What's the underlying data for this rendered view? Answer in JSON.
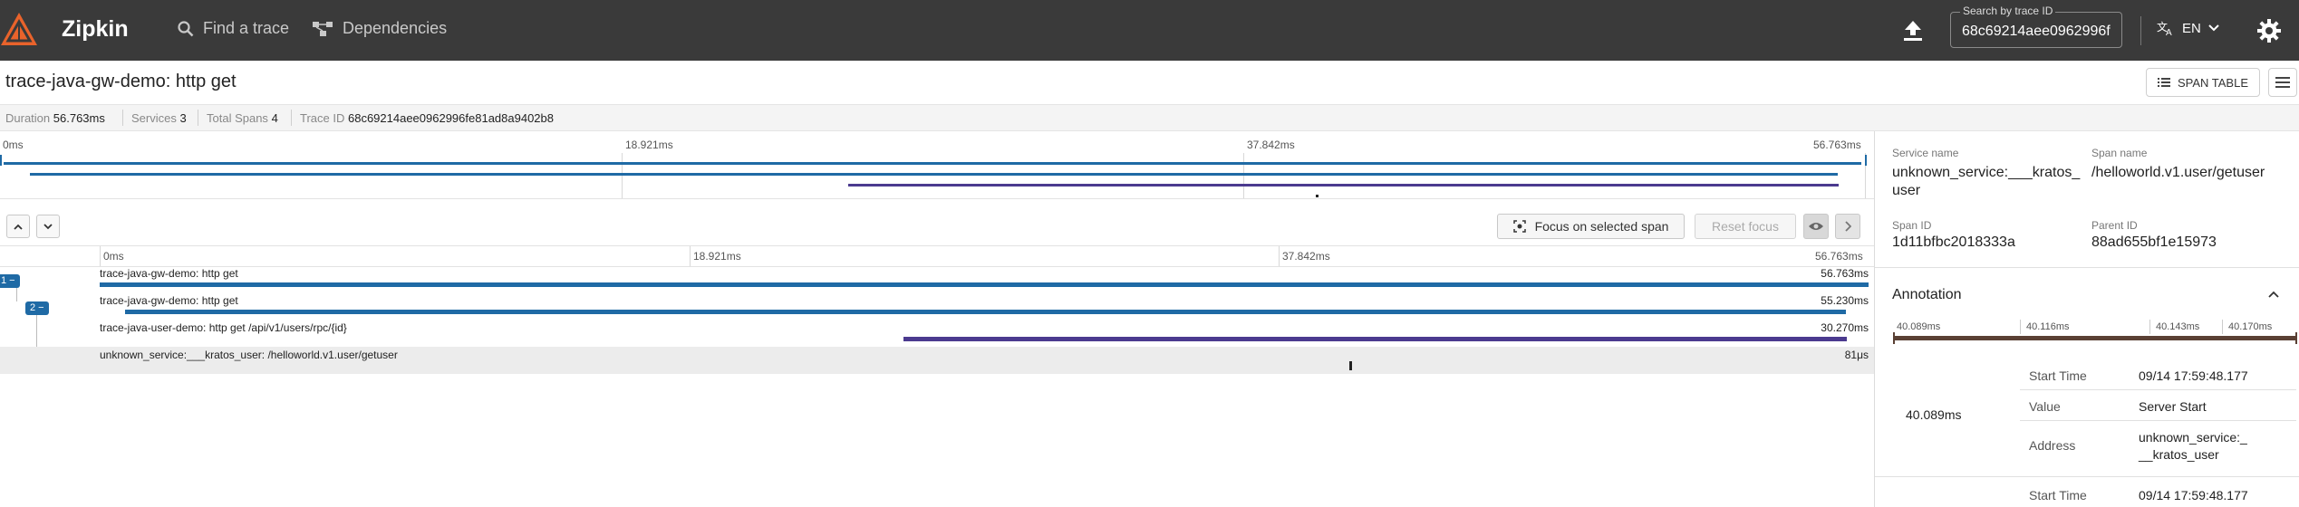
{
  "topbar": {
    "brand": "Zipkin",
    "nav": {
      "find_trace": "Find a trace",
      "dependencies": "Dependencies"
    },
    "search": {
      "legend": "Search by trace ID",
      "value": "68c69214aee0962996f"
    },
    "language": "EN",
    "colors": {
      "bar_bg": "#3a3a3a",
      "logo_orange": "#e9632b"
    }
  },
  "trace": {
    "title": "trace-java-gw-demo: http get",
    "span_table_label": "SPAN TABLE"
  },
  "summary": {
    "duration_label": "Duration",
    "duration_value": "56.763ms",
    "services_label": "Services",
    "services_value": "3",
    "spans_label": "Total Spans",
    "spans_value": "4",
    "traceid_label": "Trace ID",
    "traceid_value": "68c69214aee0962996fe81ad8a9402b8"
  },
  "timeline": {
    "ticks": [
      "0ms",
      "18.921ms",
      "37.842ms",
      "56.763ms"
    ],
    "focus_label": "Focus on selected span",
    "reset_label": "Reset focus",
    "toggles": [
      "1",
      "2"
    ],
    "colors": {
      "service_a": "#1f6aa5",
      "service_b": "#4b3a8f",
      "service_c": "#222222"
    },
    "spans": [
      {
        "name": "trace-java-gw-demo: http get",
        "duration": "56.763ms",
        "start": 0.0,
        "end": 56.763,
        "service": "service_a"
      },
      {
        "name": "trace-java-gw-demo: http get",
        "duration": "55.230ms",
        "start": 0.8,
        "end": 56.03,
        "service": "service_a"
      },
      {
        "name": "trace-java-user-demo: http get /api/v1/users/rpc/{id}",
        "duration": "30.270ms",
        "start": 25.8,
        "end": 56.07,
        "service": "service_b"
      },
      {
        "name": "unknown_service:___kratos_user: /helloworld.v1.user/getuser",
        "duration": "81μs",
        "start": 40.089,
        "end": 40.17,
        "service": "service_c"
      }
    ]
  },
  "detail": {
    "service_name_label": "Service name",
    "service_name_value": "unknown_service:___kratos_user",
    "span_name_label": "Span name",
    "span_name_value": "/helloworld.v1.user/getuser",
    "span_id_label": "Span ID",
    "span_id_value": "1d11bfbc2018333a",
    "parent_id_label": "Parent ID",
    "parent_id_value": "88ad655bf1e15973",
    "annotation_title": "Annotation",
    "annotation_ticks": [
      "40.089ms",
      "40.116ms",
      "40.143ms",
      "40.170ms"
    ],
    "annotation_color": "#5a4034",
    "annotation_time": "40.089ms",
    "rows": [
      {
        "key": "Start Time",
        "value": "09/14 17:59:48.177"
      },
      {
        "key": "Value",
        "value": "Server Start"
      },
      {
        "key": "Address",
        "value": "unknown_service:___kratos_user"
      }
    ],
    "next_row_key": "Start Time",
    "next_row_value": "09/14 17:59:48.177"
  }
}
